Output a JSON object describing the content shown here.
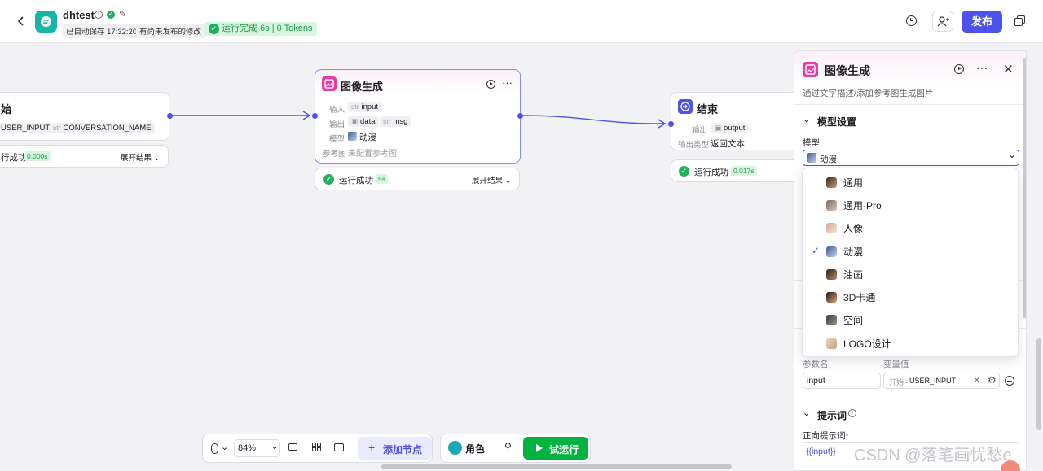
{
  "header": {
    "app_name": "dhtest",
    "autosave": "已自动保存 17:32:20",
    "unpublished": "有尚未发布的修改",
    "run_status": "运行完成 6s | 0 Tokens",
    "publish_label": "发布"
  },
  "nodes": {
    "start": {
      "title": "始",
      "param1": "USER_INPUT",
      "param2_type": "str",
      "param2": "CONVERSATION_NAME",
      "result": "行成功",
      "time": "0.000s",
      "expand": "展开结果"
    },
    "image": {
      "title": "图像生成",
      "input_label": "输入",
      "input_type": "str",
      "input": "input",
      "output_label": "输出",
      "output1": "data",
      "output2_type": "str",
      "output2": "msg",
      "model_label": "模型",
      "model": "动漫",
      "ref_label": "参考图",
      "ref": "未配置参考图",
      "result": "运行成功",
      "time": "5s",
      "expand": "展开结果"
    },
    "end": {
      "title": "结束",
      "output_label": "输出",
      "output": "output",
      "type_label": "输出类型",
      "type": "返回文本",
      "result": "运行成功",
      "time": "0.017s"
    }
  },
  "panel": {
    "title": "图像生成",
    "description": "通过文字描述/添加参考图生成图片",
    "model_settings": "模型设置",
    "model_label": "模型",
    "model_value": "动漫",
    "param_name_label": "参数名",
    "var_value_label": "变量值",
    "param_name": "input",
    "var_ref_prefix": "开始 -",
    "var_ref": "USER_INPUT",
    "prompt_section": "提示词",
    "positive_prompt_label": "正向提示词",
    "required_mark": "*",
    "prompt_value": "{{input}}"
  },
  "dropdown": {
    "options": [
      "通用",
      "通用-Pro",
      "人像",
      "动漫",
      "油画",
      "3D卡通",
      "空间",
      "LOGO设计"
    ],
    "selected": "动漫"
  },
  "toolbar": {
    "zoom": "84%",
    "add_node": "添加节点",
    "role": "角色",
    "test_run": "试运行"
  },
  "watermark": "CSDN @落笔画忧愁e",
  "colors": {
    "accent": "#4d53e8",
    "success": "#20b15a",
    "run_button": "#00b23f",
    "image_icon": "#e93ca1",
    "app_icon": "#16b6a6"
  }
}
